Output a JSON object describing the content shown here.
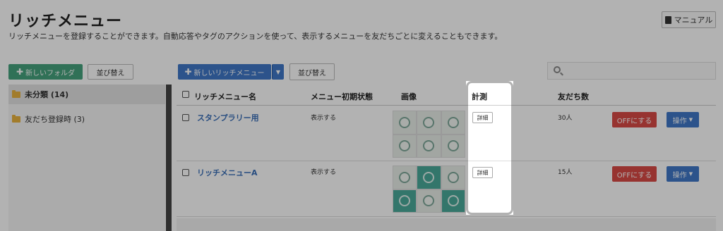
{
  "header": {
    "title": "リッチメニュー",
    "subtitle": "リッチメニューを登録することができます。自動応答やタグのアクションを使って、表示するメニューを友だちごとに変えることもできます。",
    "manual_label": "マニュアル"
  },
  "toolbar": {
    "new_folder_label": "新しいフォルダ",
    "sort_label_left": "並び替え",
    "new_richmenu_label": "新しいリッチメニュー",
    "sort_label_right": "並び替え",
    "search_placeholder": ""
  },
  "sidebar": {
    "folders": [
      {
        "label": "未分類 (14)",
        "active": true
      },
      {
        "label": "友だち登録時 (3)",
        "active": false
      }
    ]
  },
  "table": {
    "columns": [
      "リッチメニュー名",
      "メニュー初期状態",
      "画像",
      "計測",
      "友だち数"
    ],
    "rows": [
      {
        "name": "スタンプラリー用",
        "initial_state": "表示する",
        "detail_label": "詳細",
        "friends": "30人",
        "off_label": "OFFにする",
        "action_label": "操作"
      },
      {
        "name": "リッチメニューA",
        "initial_state": "表示する",
        "detail_label": "詳細",
        "friends": "15人",
        "off_label": "OFFにする",
        "action_label": "操作"
      }
    ]
  },
  "colors": {
    "green": "#46a37d",
    "blue": "#3f78c8",
    "red": "#d84a46",
    "link": "#3a6fb8",
    "teal_tile": "#4aa99a"
  },
  "icons": [
    "book-icon",
    "plus-icon",
    "chevron-down-icon",
    "search-icon",
    "folder-icon"
  ]
}
